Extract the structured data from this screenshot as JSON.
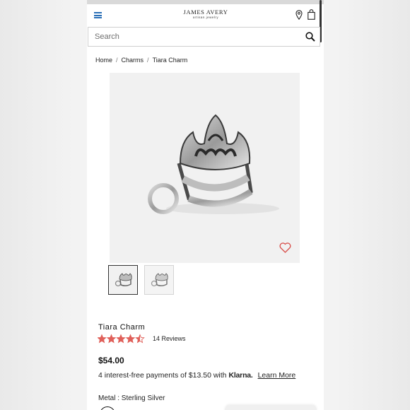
{
  "header": {
    "logo_main": "JAMES AVERY",
    "logo_sub": "artisan jewelry",
    "menu_icon": "hamburger-icon",
    "store_icon": "map-pin-icon",
    "bag_icon": "shopping-bag-icon"
  },
  "search": {
    "placeholder": "Search",
    "icon": "search-icon"
  },
  "breadcrumb": {
    "items": [
      "Home",
      "Charms",
      "Tiara Charm"
    ]
  },
  "product": {
    "title": "Tiara Charm",
    "rating": 4.5,
    "rating_max": 5,
    "reviews_label": "14 Reviews",
    "price": "$54.00",
    "installments_text": "4 interest-free payments of $13.50 with",
    "klarna_label": "Klarna.",
    "learn_more_label": "Learn More",
    "metal_label": "Metal : Sterling Silver",
    "wishlist_icon": "heart-icon"
  },
  "colors": {
    "accent_blue": "#2a6fb6",
    "star_red": "#e0605a",
    "heart_red": "#d9534f",
    "image_bg": "#f1f1f1"
  }
}
